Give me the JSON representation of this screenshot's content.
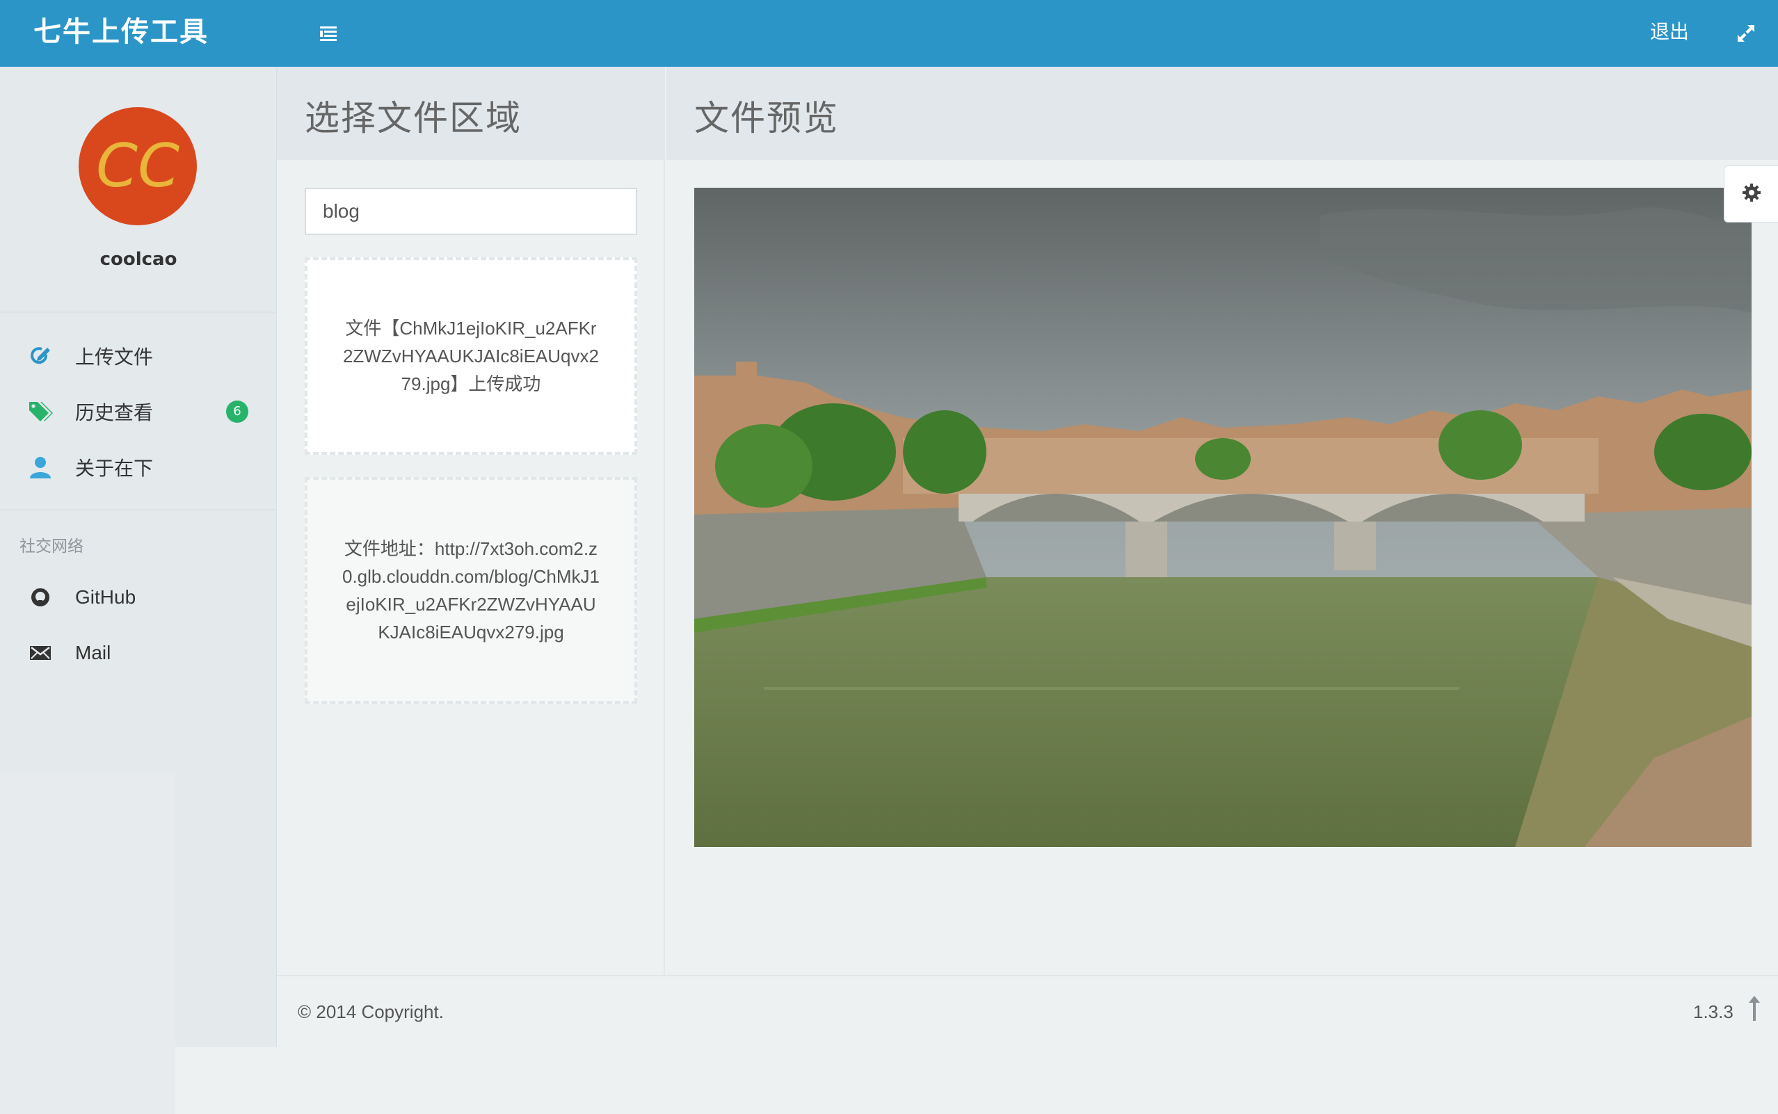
{
  "header": {
    "brand": "七牛上传工具",
    "menu_icon": "list-icon",
    "logout_label": "退出",
    "fullscreen_icon": "expand-icon",
    "bg_color": "#2b95c8"
  },
  "sidebar": {
    "avatar_text": "CC",
    "avatar_color": "#d9481d",
    "username": "coolcao",
    "items": [
      {
        "label": "上传文件",
        "icon": "edit-icon"
      },
      {
        "label": "历史查看",
        "icon": "tags-icon",
        "badge": "6"
      },
      {
        "label": "关于在下",
        "icon": "user-icon"
      }
    ],
    "social_title": "社交网络",
    "social": [
      {
        "label": "GitHub",
        "icon": "github-icon"
      },
      {
        "label": "Mail",
        "icon": "envelope-icon"
      }
    ]
  },
  "upload_panel": {
    "title": "选择文件区域",
    "input_value": "blog",
    "status_message": "文件【ChMkJ1ejIoKIR_u2AFKr2ZWZvHYAAUKJAIc8iEAUqvx279.jpg】上传成功",
    "url_message": "文件地址：http://7xt3oh.com2.z0.glb.clouddn.com/blog/ChMkJ1ejIoKIR_u2AFKr2ZWZvHYAAUKJAIc8iEAUqvx279.jpg"
  },
  "preview_panel": {
    "title": "文件预览",
    "image_alt": "river-bridge-photo",
    "settings_icon": "gear-icon"
  },
  "footer": {
    "copyright": "© 2014 Copyright.",
    "version": "1.3.3",
    "to_top_icon": "arrow-up-icon"
  }
}
